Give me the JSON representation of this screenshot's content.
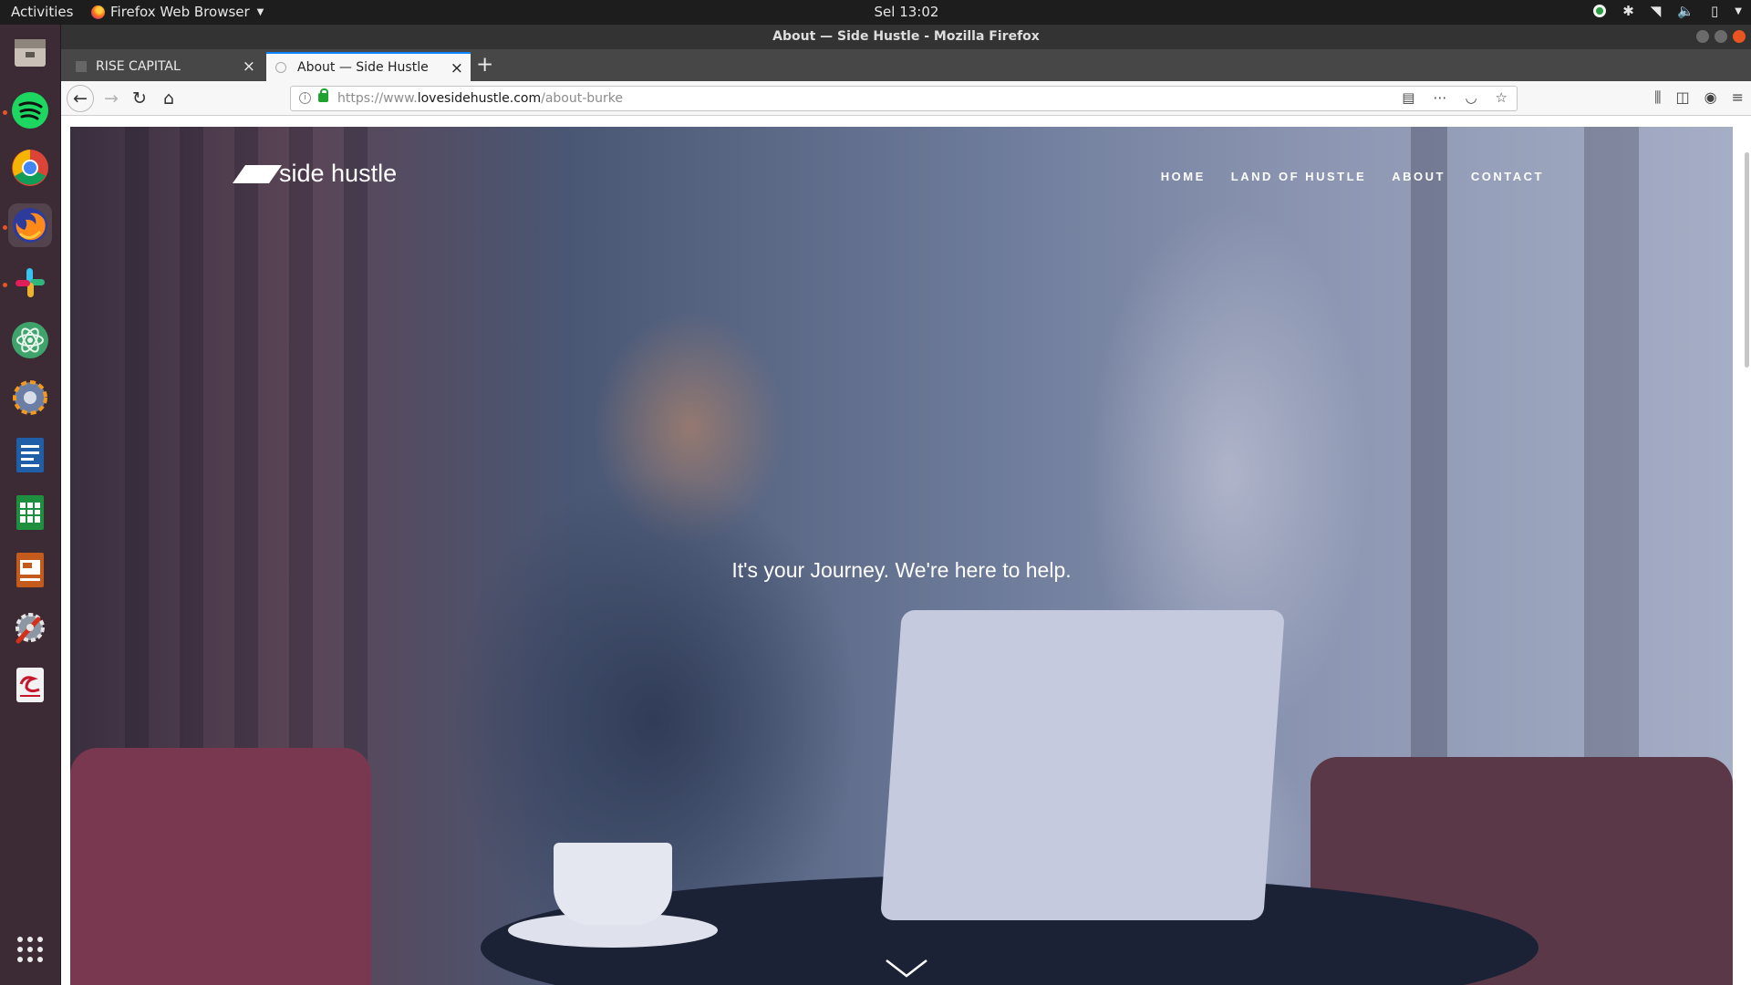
{
  "topbar": {
    "activities": "Activities",
    "app_name": "Firefox Web Browser",
    "clock": "Sel 13:02"
  },
  "window": {
    "title": "About — Side Hustle - Mozilla Firefox"
  },
  "tabs": [
    {
      "label": "RISE CAPITAL",
      "active": false
    },
    {
      "label": "About — Side Hustle",
      "active": true
    }
  ],
  "url": {
    "prefix": "https://www.",
    "domain": "lovesidehustle.com",
    "path": "/about-burke"
  },
  "dock": [
    "files",
    "spotify",
    "chrome",
    "firefox",
    "slack",
    "atom",
    "settings-wheel",
    "writer",
    "calc",
    "impress",
    "system-tools",
    "text-editor",
    "show-apps"
  ],
  "site": {
    "logo": "side hustle",
    "nav": [
      "HOME",
      "LAND OF HUSTLE",
      "ABOUT",
      "CONTACT"
    ],
    "tagline": "It's your Journey. We're here to help."
  },
  "colors": {
    "accent": "#e95420",
    "tab_active_border": "#0a84ff",
    "dock_bg": "#3c2a34"
  }
}
